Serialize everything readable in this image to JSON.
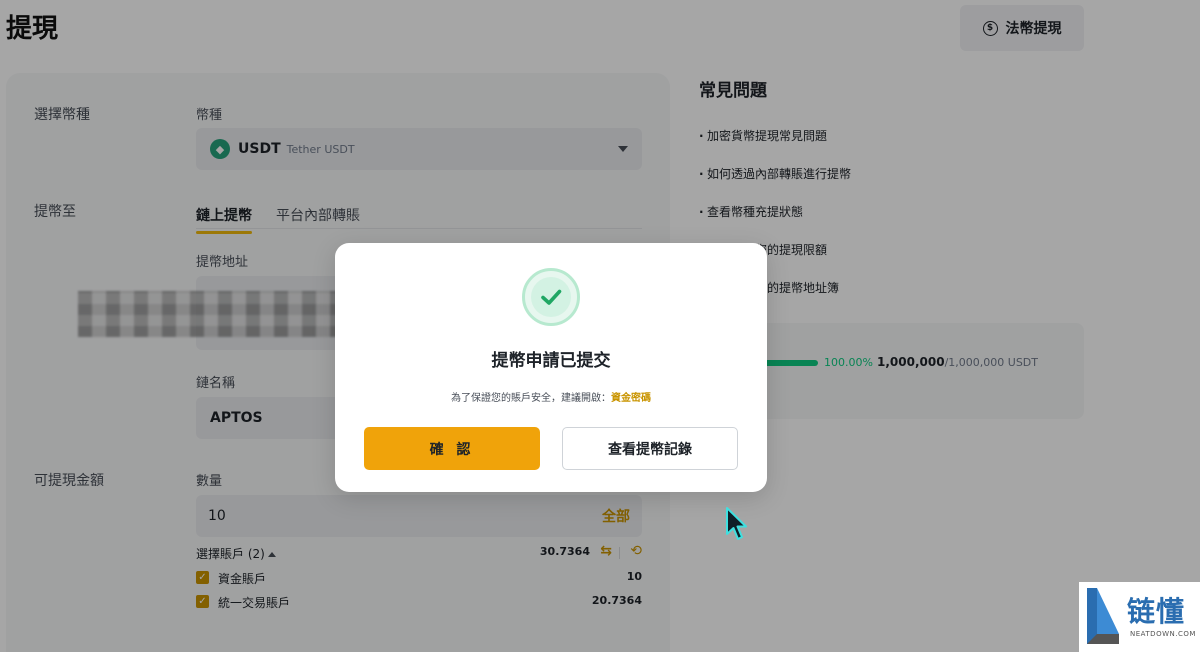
{
  "page": {
    "title": "提現"
  },
  "header": {
    "fiat_withdraw_label": "法幣提現"
  },
  "form": {
    "select_coin_label": "選擇幣種",
    "coin_field_label": "幣種",
    "coin": {
      "symbol": "USDT",
      "name": "Tether USDT",
      "color": "#26a17b"
    },
    "withdraw_to_label": "提幣至",
    "tabs": [
      {
        "label": "鏈上提幣",
        "active": true
      },
      {
        "label": "平台內部轉賬",
        "active": false
      }
    ],
    "address_label": "提幣地址",
    "network_label": "鏈名稱",
    "network_value": "APTOS",
    "available_label": "可提現金額",
    "quantity_label": "數量",
    "quantity_value": "10",
    "all_label": "全部",
    "accounts_label": "選擇賬戶 (2)",
    "accounts_total": "30.7364",
    "accounts": [
      {
        "name": "資金賬戶",
        "value": "10",
        "checked": true
      },
      {
        "name": "統一交易賬戶",
        "value": "20.7364",
        "checked": true
      }
    ]
  },
  "faq": {
    "title": "常見問題",
    "items": [
      {
        "label": "加密貨幣提現常見問題"
      },
      {
        "label": "如何透過內部轉賬進行提幣"
      },
      {
        "label": "查看幣種充提狀態"
      },
      {
        "label": "如何更改您的提現限額"
      },
      {
        "label": "如何管理您的提幣地址簿"
      }
    ]
  },
  "limit": {
    "percent": "100.00%",
    "used": "1,000,000",
    "total": "/1,000,000 USDT",
    "fill": 1.0
  },
  "modal": {
    "title": "提幣申請已提交",
    "message": "為了保證您的賬戶安全，建議開啟：",
    "link": "資金密碼",
    "confirm_label": "確 認",
    "history_label": "查看提幣記錄"
  },
  "watermark": {
    "main": "链懂",
    "sub": "NEATDOWN.COM"
  },
  "colors": {
    "accent": "#f0b90b",
    "success": "#0ecb81",
    "link": "#c99400"
  }
}
